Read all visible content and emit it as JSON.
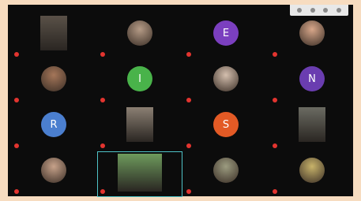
{
  "toolbar": {
    "icons": [
      "grid-icon",
      "settings-icon",
      "more-icon",
      "expand-icon"
    ]
  },
  "participants": [
    {
      "id": 1,
      "kind": "video",
      "color": "#5a5148"
    },
    {
      "id": 2,
      "kind": "photo",
      "color": "#b59b86"
    },
    {
      "id": 3,
      "kind": "letter",
      "letter": "E",
      "color": "#7b3fbf"
    },
    {
      "id": 4,
      "kind": "photo",
      "color": "#d8a78a"
    },
    {
      "id": 5,
      "kind": "photo",
      "color": "#a57659"
    },
    {
      "id": 6,
      "kind": "letter",
      "letter": "I",
      "color": "#49b34a"
    },
    {
      "id": 7,
      "kind": "photo",
      "color": "#d4bfae"
    },
    {
      "id": 8,
      "kind": "letter",
      "letter": "N",
      "color": "#6a3db0"
    },
    {
      "id": 9,
      "kind": "letter",
      "letter": "R",
      "color": "#4b7fcf"
    },
    {
      "id": 10,
      "kind": "video",
      "color": "#8b7f73"
    },
    {
      "id": 11,
      "kind": "letter",
      "letter": "S",
      "color": "#e35a25"
    },
    {
      "id": 12,
      "kind": "video",
      "color": "#6b6b62"
    },
    {
      "id": 13,
      "kind": "photo",
      "color": "#c7a28a"
    },
    {
      "id": 14,
      "kind": "video",
      "color": "#6e9b5d",
      "active": true
    },
    {
      "id": 15,
      "kind": "photo",
      "color": "#9c9c80"
    },
    {
      "id": 16,
      "kind": "photo",
      "color": "#c8b36a"
    }
  ]
}
